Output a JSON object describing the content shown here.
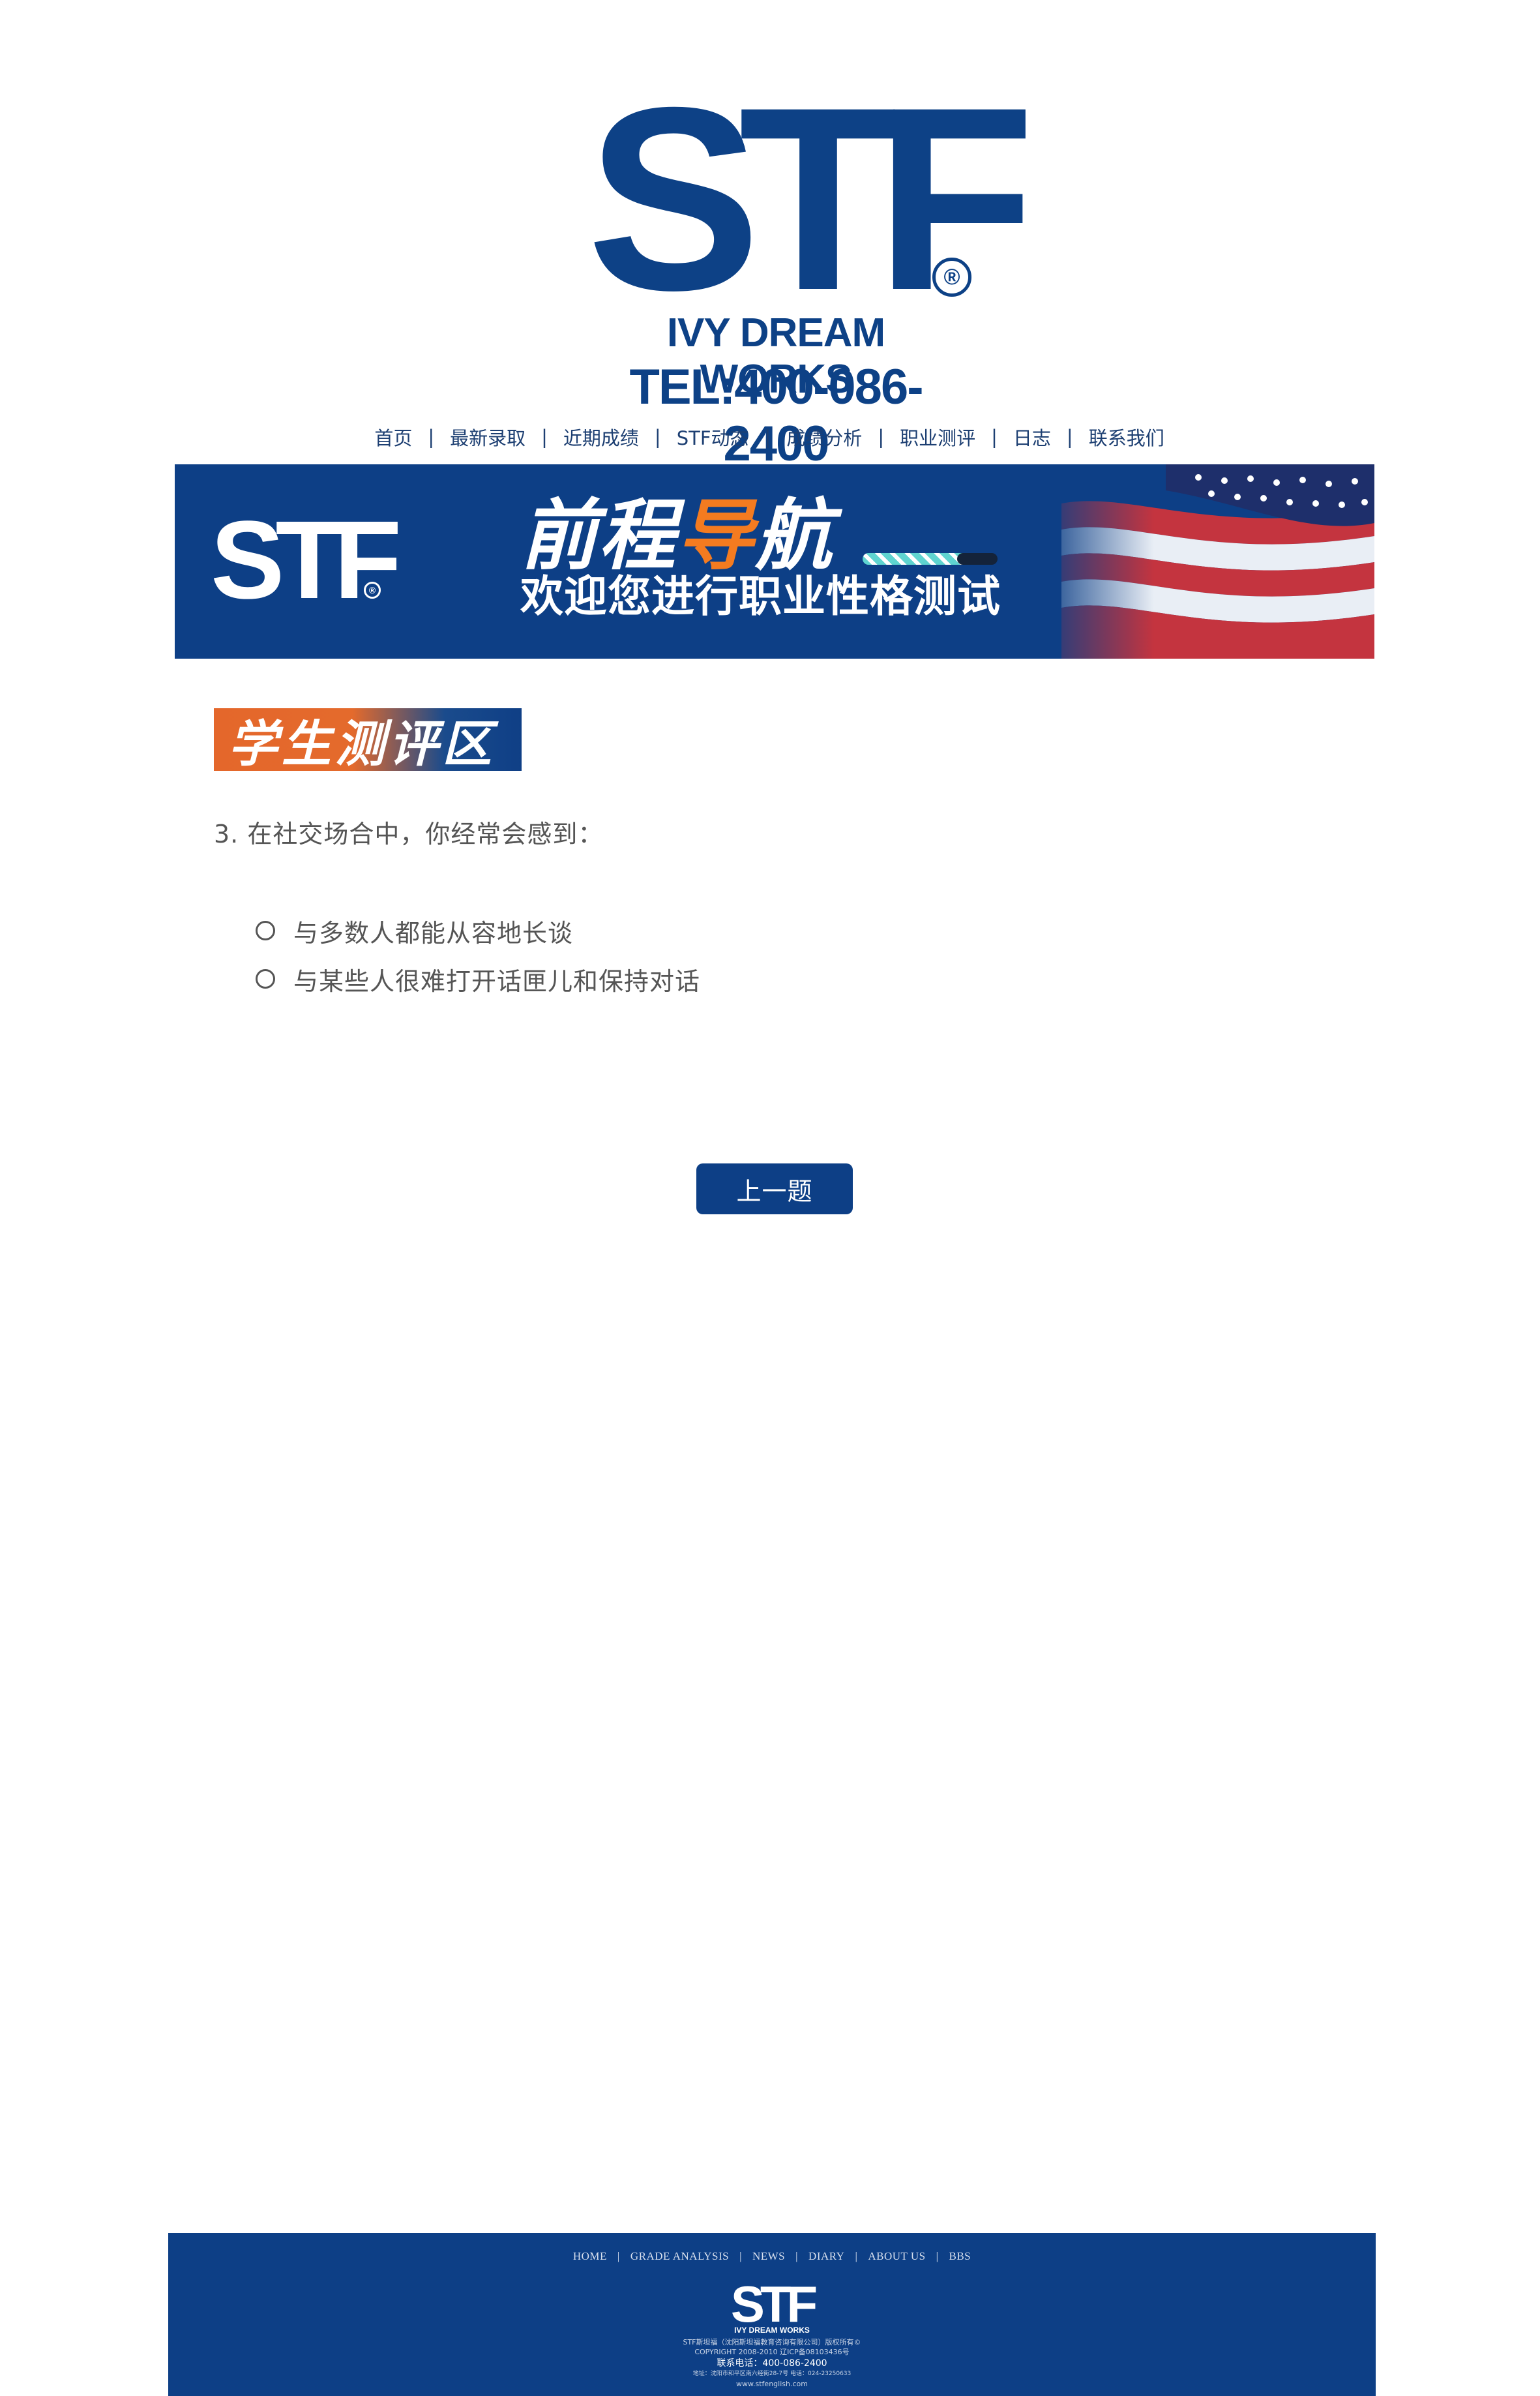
{
  "header": {
    "logo_text": "STF",
    "logo_registered": "®",
    "logo_tagline": "IVY DREAM WORKS",
    "phone": "TEL:400-086-2400"
  },
  "nav": {
    "items": [
      "首页",
      "最新录取",
      "近期成绩",
      "STF动态",
      "成绩分析",
      "职业测评",
      "日志",
      "联系我们"
    ],
    "separator": "|"
  },
  "banner": {
    "logo_text": "STF",
    "logo_registered": "®",
    "title_part1": "前程",
    "title_highlight": "导",
    "title_part2": "航",
    "subtitle": "欢迎您进行职业性格测试",
    "colors": {
      "background": "#0d3f86",
      "highlight": "#f47b20"
    }
  },
  "section": {
    "badge_label": "学生测评区"
  },
  "question": {
    "text": "3. 在社交场合中，你经常会感到：",
    "options": [
      {
        "label": "与多数人都能从容地长谈"
      },
      {
        "label": "与某些人很难打开话匣儿和保持对话"
      }
    ]
  },
  "actions": {
    "prev_label": "上一题"
  },
  "footer": {
    "nav": [
      "HOME",
      "GRADE ANALYSIS",
      "NEWS",
      "DIARY",
      "ABOUT US",
      "BBS"
    ],
    "logo_text": "STF",
    "logo_tagline": "IVY DREAM WORKS",
    "lines": [
      "STF斯坦福（沈阳斯坦福教育咨询有限公司）版权所有©",
      "COPYRIGHT 2008-2010 辽ICP备08103436号",
      "联系电话：400-086-2400",
      "地址：沈阳市和平区南六经街28-7号 电话：024-23250633",
      "www.stfenglish.com"
    ]
  }
}
